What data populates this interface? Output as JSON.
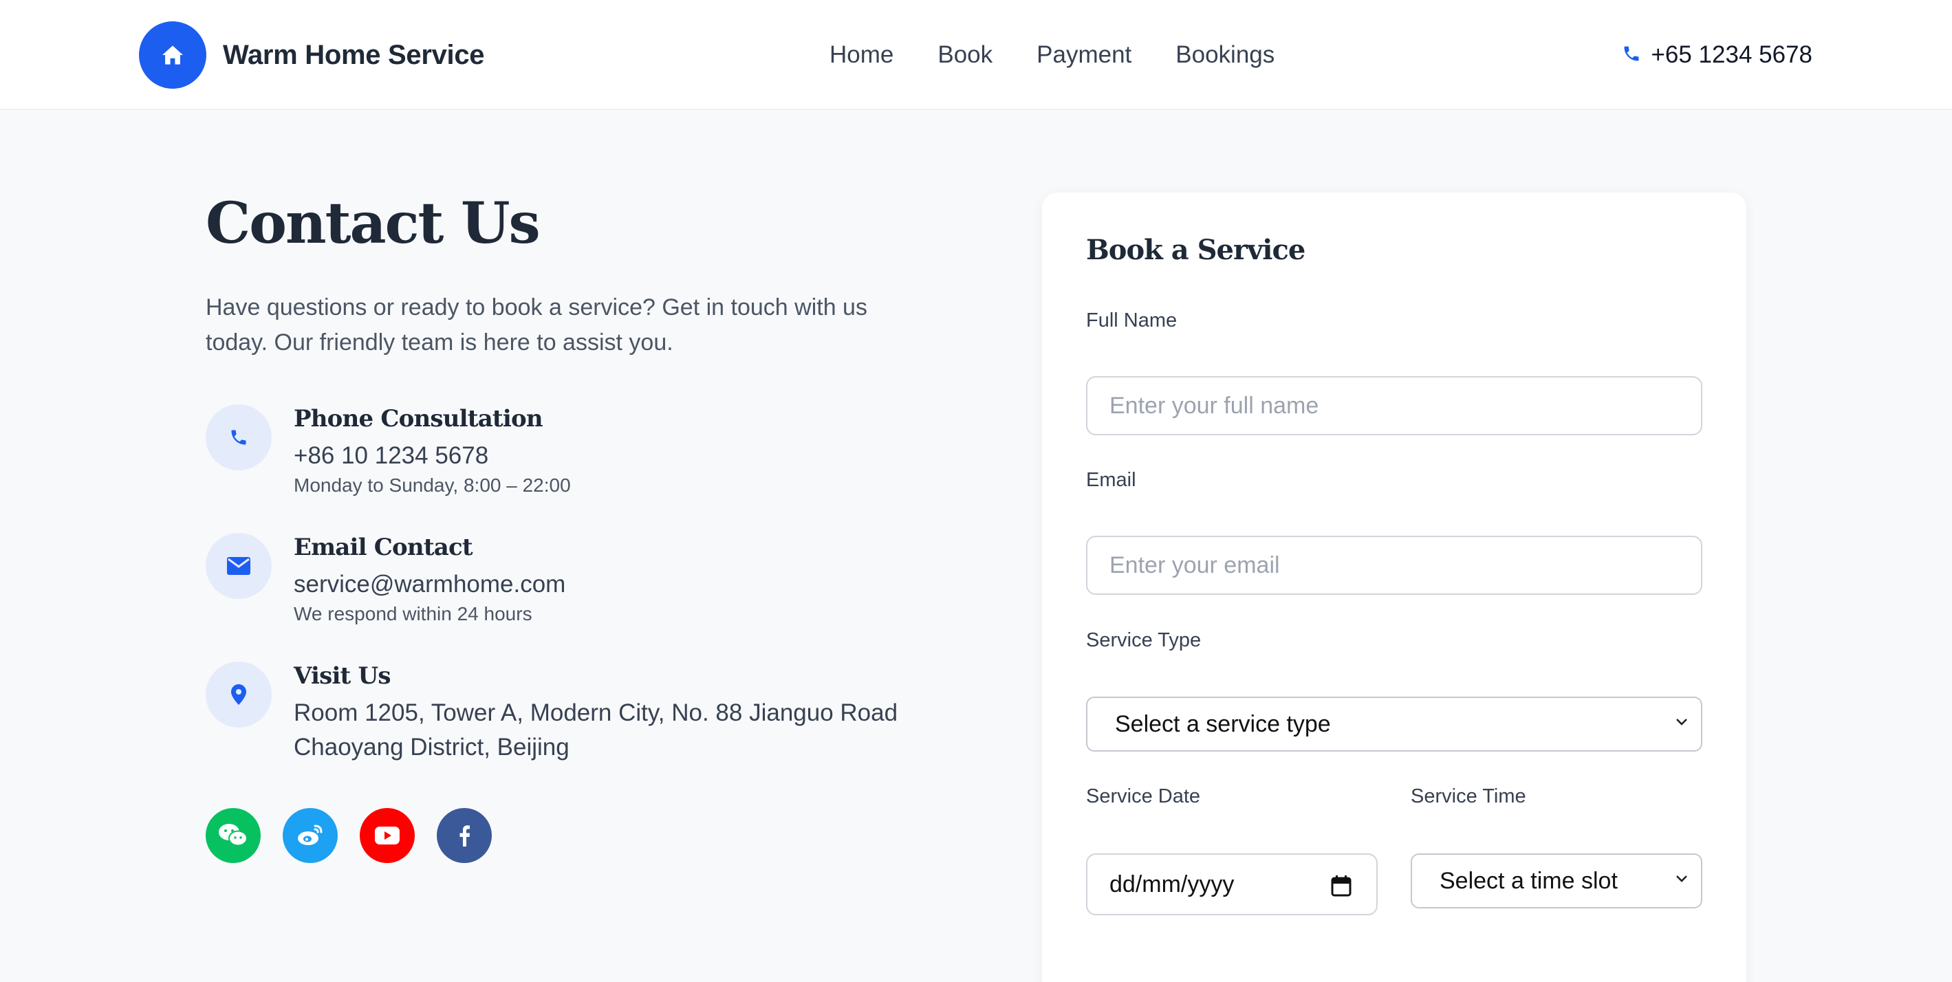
{
  "header": {
    "brand_name": "Warm Home Service",
    "nav": [
      "Home",
      "Book",
      "Payment",
      "Bookings"
    ],
    "phone": "+65 1234 5678"
  },
  "contact": {
    "title": "Contact Us",
    "intro": "Have questions or ready to book a service? Get in touch with us today. Our friendly team is here to assist you.",
    "items": [
      {
        "title": "Phone Consultation",
        "main": "+86 10 1234 5678",
        "sub": "Monday to Sunday, 8:00 – 22:00",
        "icon": "phone-icon"
      },
      {
        "title": "Email Contact",
        "main": "service@warmhome.com",
        "sub": "We respond within 24 hours",
        "icon": "envelope-icon"
      },
      {
        "title": "Visit Us",
        "main": "Room 1205, Tower A, Modern City, No. 88 Jianguo Road",
        "sub": "Chaoyang District, Beijing",
        "icon": "map-pin-icon"
      }
    ],
    "socials": [
      {
        "name": "wechat",
        "color": "#07c160"
      },
      {
        "name": "weibo",
        "color": "#1da1f2"
      },
      {
        "name": "youtube",
        "color": "#ff0000"
      },
      {
        "name": "facebook",
        "color": "#3b5998"
      }
    ]
  },
  "form": {
    "title": "Book a Service",
    "full_name_label": "Full Name",
    "full_name_placeholder": "Enter your full name",
    "email_label": "Email",
    "email_placeholder": "Enter your email",
    "service_type_label": "Service Type",
    "service_type_value": "Select a service type",
    "service_date_label": "Service Date",
    "service_date_value": "dd/mm/yyyy",
    "service_time_label": "Service Time",
    "service_time_value": "Select a time slot"
  },
  "colors": {
    "accent": "#1c5ef0",
    "icon_bg": "#e4ebfb",
    "page_bg": "#f8f9fb"
  }
}
